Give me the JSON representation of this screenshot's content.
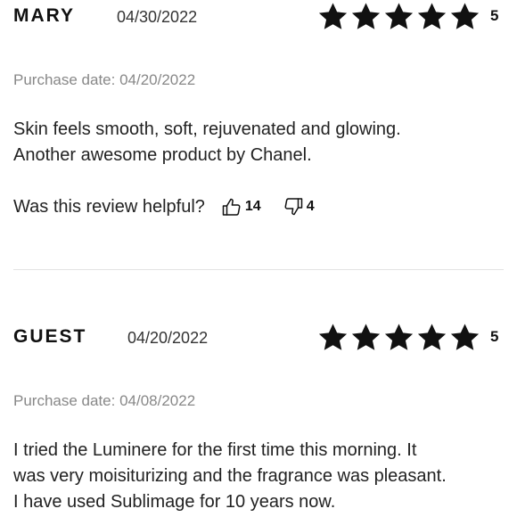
{
  "reviews": [
    {
      "name": "MARY",
      "date": "04/30/2022",
      "rating": 5,
      "rating_label": "5",
      "purchase_date": "Purchase date: 04/20/2022",
      "body_lines": [
        "Skin feels smooth, soft, rejuvenated and glowing.",
        "Another awesome product by Chanel."
      ],
      "helpful_prompt": "Was this review helpful?",
      "yes_count": "14",
      "no_count": "4"
    },
    {
      "name": "GUEST",
      "date": "04/20/2022",
      "rating": 5,
      "rating_label": "5",
      "purchase_date": "Purchase date: 04/08/2022",
      "body_lines": [
        "I tried the Luminere for the first time this morning. It",
        "was very moisiturizing and the fragrance was pleasant.",
        "I have used Sublimage for 10 years now."
      ]
    }
  ],
  "icons": {
    "star": "star-icon",
    "thumbs_up": "thumbs-up-icon",
    "thumbs_down": "thumbs-down-icon"
  },
  "colors": {
    "star_fill": "#111111",
    "divider": "#e2e2e2",
    "muted_text": "#888888"
  }
}
